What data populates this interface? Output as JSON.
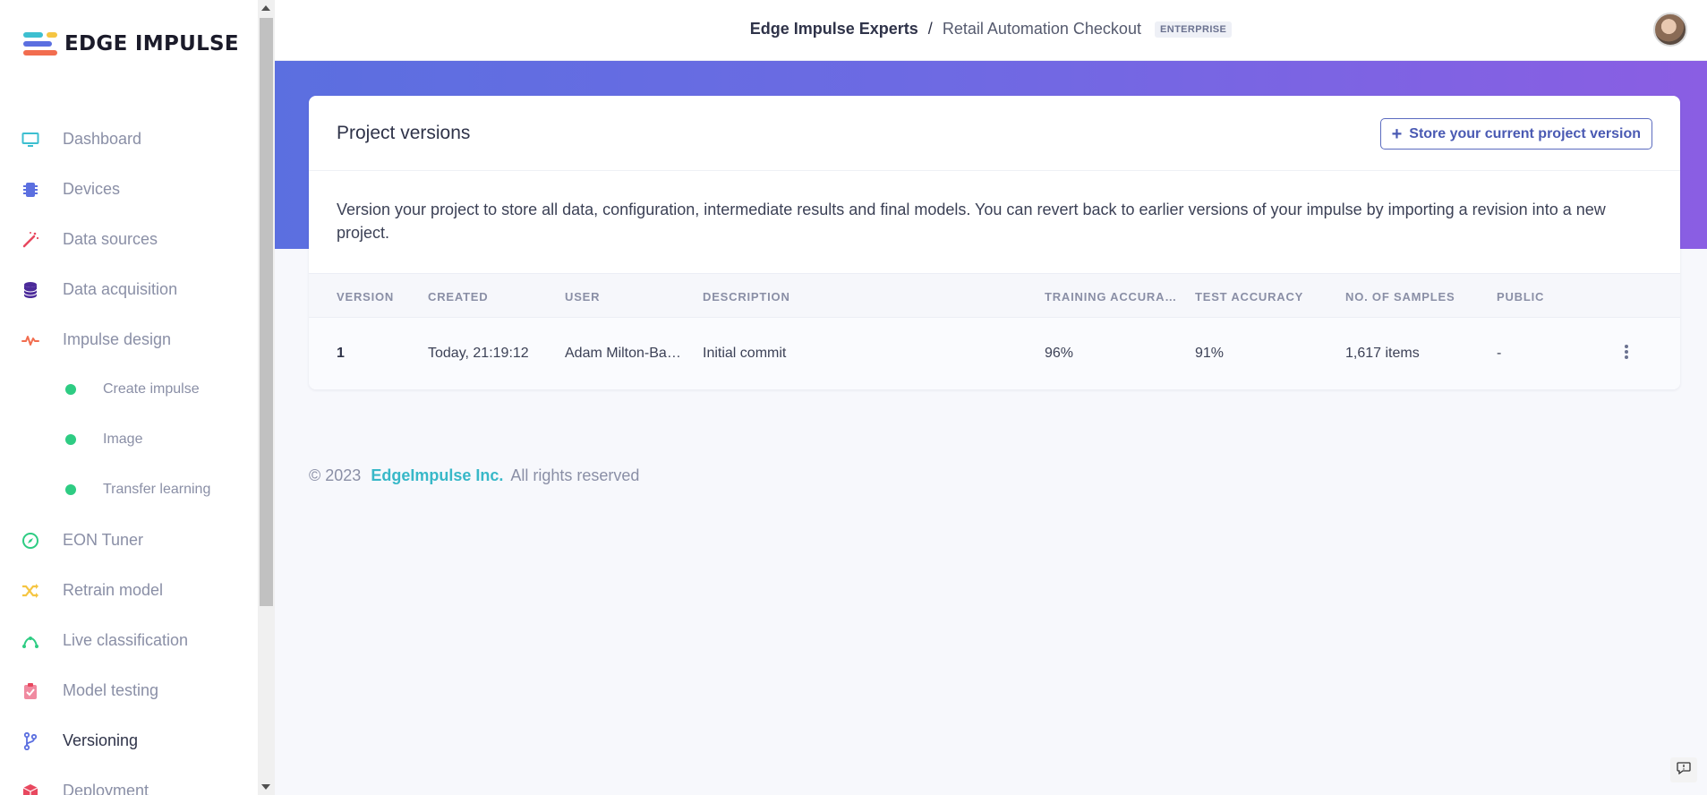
{
  "brand": {
    "name": "EDGE IMPULSE"
  },
  "sidebar": {
    "items": [
      {
        "label": "Dashboard"
      },
      {
        "label": "Devices"
      },
      {
        "label": "Data sources"
      },
      {
        "label": "Data acquisition"
      },
      {
        "label": "Impulse design"
      },
      {
        "label": "Create impulse"
      },
      {
        "label": "Image"
      },
      {
        "label": "Transfer learning"
      },
      {
        "label": "EON Tuner"
      },
      {
        "label": "Retrain model"
      },
      {
        "label": "Live classification"
      },
      {
        "label": "Model testing"
      },
      {
        "label": "Versioning"
      },
      {
        "label": "Deployment"
      }
    ],
    "active": "Versioning"
  },
  "header": {
    "org": "Edge Impulse Experts",
    "separator": "/",
    "project": "Retail Automation Checkout",
    "badge": "ENTERPRISE"
  },
  "card": {
    "title": "Project versions",
    "store_button": "Store your current project version",
    "description": "Version your project to store all data, configuration, intermediate results and final models. You can revert back to earlier versions of your impulse by importing a revision into a new project.",
    "columns": [
      "VERSION",
      "CREATED",
      "USER",
      "DESCRIPTION",
      "TRAINING ACCURACY",
      "TEST ACCURACY",
      "NO. OF SAMPLES",
      "PUBLIC"
    ],
    "rows": [
      {
        "version": "1",
        "created": "Today, 21:19:12",
        "user": "Adam Milton-Barker",
        "description": "Initial commit",
        "training_accuracy": "96%",
        "test_accuracy": "91%",
        "samples": "1,617 items",
        "public": "-"
      }
    ]
  },
  "footer": {
    "copyright": "© 2023",
    "company": "EdgeImpulse Inc.",
    "rights": "All rights reserved"
  },
  "colors": {
    "accent": "#4a5ab3",
    "banner_start": "#5b6fe0",
    "banner_end": "#8a5ee3",
    "link": "#38b8c8",
    "status_dot": "#2ecc83"
  }
}
